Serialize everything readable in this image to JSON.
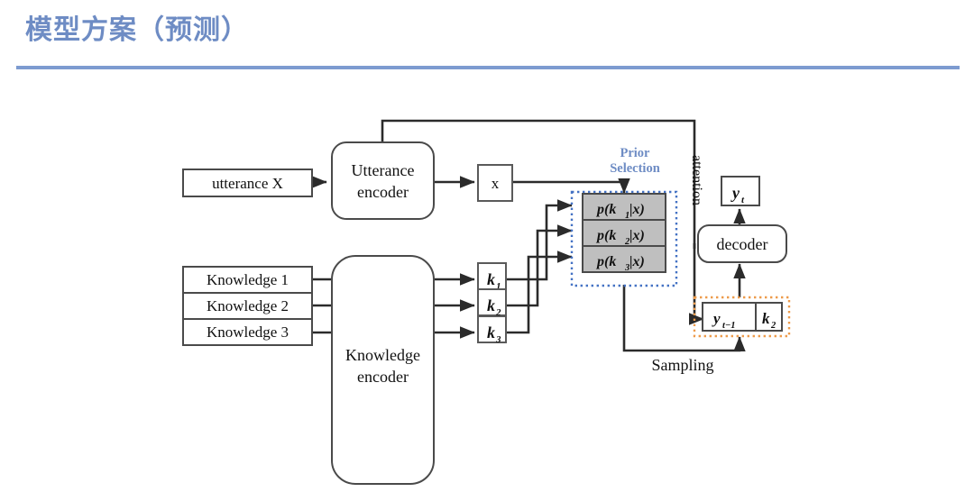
{
  "slide": {
    "title": "模型方案（预测）",
    "title_color": "#6E8CC4",
    "rule_color": "#7d9bd0"
  },
  "diagram": {
    "colors": {
      "stroke": "#3f3f3f",
      "gray_fill": "#bfbfbf",
      "prior_border": "#4472c4",
      "sampling_border": "#ed9b4b",
      "label_blue": "#6E8CC4"
    },
    "nodes": {
      "utterance_input": "utterance X",
      "utterance_encoder_line1": "Utterance",
      "utterance_encoder_line2": "encoder",
      "x_vector": "x",
      "knowledge_1": "Knowledge 1",
      "knowledge_2": "Knowledge 2",
      "knowledge_3": "Knowledge 3",
      "knowledge_encoder_line1": "Knowledge",
      "knowledge_encoder_line2": "encoder",
      "k1": "k",
      "k1_sub": "1",
      "k2": "k",
      "k2_sub": "2",
      "k3": "k",
      "k3_sub": "3",
      "prior_cell_1_pre": "p(k",
      "prior_cell_1_sub": "1",
      "prior_cell_1_post": "|x)",
      "prior_cell_2_pre": "p(k",
      "prior_cell_2_sub": "2",
      "prior_cell_2_post": "|x)",
      "prior_cell_3_pre": "p(k",
      "prior_cell_3_sub": "3",
      "prior_cell_3_post": "|x)",
      "decoder": "decoder",
      "y_t": "y",
      "y_t_sub": "t",
      "y_prev": "y",
      "y_prev_sub": "t−1",
      "sel_k": "k",
      "sel_k_sub": "2"
    },
    "labels": {
      "prior_selection_line1": "Prior",
      "prior_selection_line2": "Selection",
      "attention": "attention",
      "sampling": "Sampling"
    }
  }
}
